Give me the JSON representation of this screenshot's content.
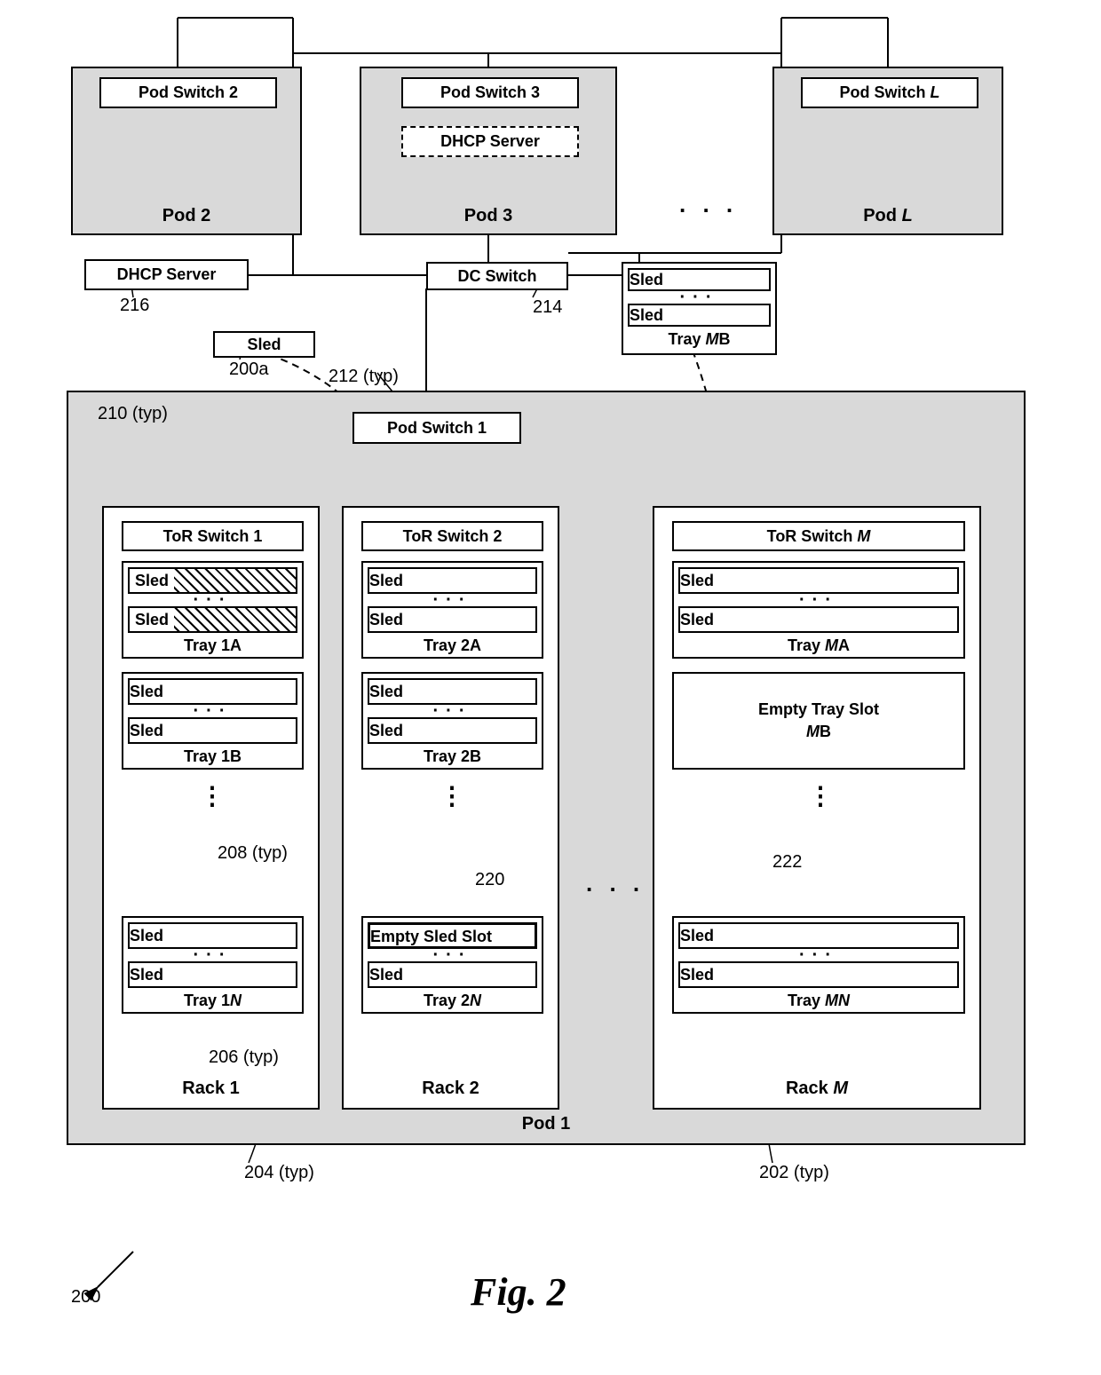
{
  "pods_top": {
    "pod2": {
      "switch": "Pod Switch 2",
      "label": "Pod 2"
    },
    "pod3": {
      "switch": "Pod Switch 3",
      "dhcp": "DHCP Server",
      "label": "Pod 3"
    },
    "podL": {
      "switch_pre": "Pod Switch ",
      "switch_L": "L",
      "label_pre": "Pod ",
      "label_L": "L"
    }
  },
  "dhcp_server": "DHCP Server",
  "dc_switch": "DC Switch",
  "floating_sled": "Sled",
  "tray_mb_float": {
    "sled1": "Sled",
    "sled2": "Sled",
    "label_pre": "Tray ",
    "label_m": "M",
    "label_b": "B"
  },
  "pod1": {
    "switch": "Pod Switch 1",
    "label": "Pod 1",
    "rack1": {
      "tor": "ToR Switch 1",
      "label": "Rack 1",
      "tray_a": {
        "s1": "Sled",
        "s2": "Sled",
        "label": "Tray 1A"
      },
      "tray_b": {
        "s1": "Sled",
        "s2": "Sled",
        "label": "Tray 1B"
      },
      "tray_n": {
        "s1": "Sled",
        "s2": "Sled",
        "label_pre": "Tray 1",
        "label_n": "N"
      }
    },
    "rack2": {
      "tor": "ToR Switch 2",
      "label": "Rack 2",
      "tray_a": {
        "s1": "Sled",
        "s2": "Sled",
        "label": "Tray 2A"
      },
      "tray_b": {
        "s1": "Sled",
        "s2": "Sled",
        "label": "Tray 2B"
      },
      "tray_n": {
        "s1": "Empty Sled Slot",
        "s2": "Sled",
        "label_pre": "Tray 2",
        "label_n": "N"
      }
    },
    "rackM": {
      "tor_pre": "ToR Switch ",
      "tor_m": "M",
      "label_pre": "Rack ",
      "label_m": "M",
      "tray_a": {
        "s1": "Sled",
        "s2": "Sled",
        "label_pre": "Tray ",
        "label_m": "M",
        "label_a": "A"
      },
      "empty_slot_l1": "Empty Tray Slot",
      "empty_slot_pre": "",
      "empty_slot_m": "M",
      "empty_slot_b": "B",
      "tray_n": {
        "s1": "Sled",
        "s2": "Sled",
        "label_pre": "Tray ",
        "label_m": "M",
        "label_n": "N"
      }
    }
  },
  "callouts": {
    "c216": "216",
    "c214": "214",
    "c200a": "200a",
    "c210": "210 (typ)",
    "c212": "212 (typ)",
    "c208": "208 (typ)",
    "c220": "220",
    "c222": "222",
    "c206": "206 (typ)",
    "c204": "204 (typ)",
    "c202": "202 (typ)",
    "c200": "200"
  },
  "ellipsis_top": ". . .",
  "ellipsis_racks": ". . .",
  "figure": "Fig. 2"
}
